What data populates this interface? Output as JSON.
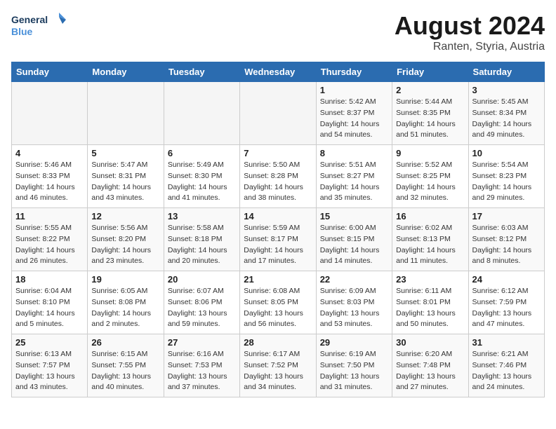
{
  "header": {
    "logo_line1": "General",
    "logo_line2": "Blue",
    "month": "August 2024",
    "location": "Ranten, Styria, Austria"
  },
  "weekdays": [
    "Sunday",
    "Monday",
    "Tuesday",
    "Wednesday",
    "Thursday",
    "Friday",
    "Saturday"
  ],
  "weeks": [
    [
      {
        "day": "",
        "info": ""
      },
      {
        "day": "",
        "info": ""
      },
      {
        "day": "",
        "info": ""
      },
      {
        "day": "",
        "info": ""
      },
      {
        "day": "1",
        "info": "Sunrise: 5:42 AM\nSunset: 8:37 PM\nDaylight: 14 hours\nand 54 minutes."
      },
      {
        "day": "2",
        "info": "Sunrise: 5:44 AM\nSunset: 8:35 PM\nDaylight: 14 hours\nand 51 minutes."
      },
      {
        "day": "3",
        "info": "Sunrise: 5:45 AM\nSunset: 8:34 PM\nDaylight: 14 hours\nand 49 minutes."
      }
    ],
    [
      {
        "day": "4",
        "info": "Sunrise: 5:46 AM\nSunset: 8:33 PM\nDaylight: 14 hours\nand 46 minutes."
      },
      {
        "day": "5",
        "info": "Sunrise: 5:47 AM\nSunset: 8:31 PM\nDaylight: 14 hours\nand 43 minutes."
      },
      {
        "day": "6",
        "info": "Sunrise: 5:49 AM\nSunset: 8:30 PM\nDaylight: 14 hours\nand 41 minutes."
      },
      {
        "day": "7",
        "info": "Sunrise: 5:50 AM\nSunset: 8:28 PM\nDaylight: 14 hours\nand 38 minutes."
      },
      {
        "day": "8",
        "info": "Sunrise: 5:51 AM\nSunset: 8:27 PM\nDaylight: 14 hours\nand 35 minutes."
      },
      {
        "day": "9",
        "info": "Sunrise: 5:52 AM\nSunset: 8:25 PM\nDaylight: 14 hours\nand 32 minutes."
      },
      {
        "day": "10",
        "info": "Sunrise: 5:54 AM\nSunset: 8:23 PM\nDaylight: 14 hours\nand 29 minutes."
      }
    ],
    [
      {
        "day": "11",
        "info": "Sunrise: 5:55 AM\nSunset: 8:22 PM\nDaylight: 14 hours\nand 26 minutes."
      },
      {
        "day": "12",
        "info": "Sunrise: 5:56 AM\nSunset: 8:20 PM\nDaylight: 14 hours\nand 23 minutes."
      },
      {
        "day": "13",
        "info": "Sunrise: 5:58 AM\nSunset: 8:18 PM\nDaylight: 14 hours\nand 20 minutes."
      },
      {
        "day": "14",
        "info": "Sunrise: 5:59 AM\nSunset: 8:17 PM\nDaylight: 14 hours\nand 17 minutes."
      },
      {
        "day": "15",
        "info": "Sunrise: 6:00 AM\nSunset: 8:15 PM\nDaylight: 14 hours\nand 14 minutes."
      },
      {
        "day": "16",
        "info": "Sunrise: 6:02 AM\nSunset: 8:13 PM\nDaylight: 14 hours\nand 11 minutes."
      },
      {
        "day": "17",
        "info": "Sunrise: 6:03 AM\nSunset: 8:12 PM\nDaylight: 14 hours\nand 8 minutes."
      }
    ],
    [
      {
        "day": "18",
        "info": "Sunrise: 6:04 AM\nSunset: 8:10 PM\nDaylight: 14 hours\nand 5 minutes."
      },
      {
        "day": "19",
        "info": "Sunrise: 6:05 AM\nSunset: 8:08 PM\nDaylight: 14 hours\nand 2 minutes."
      },
      {
        "day": "20",
        "info": "Sunrise: 6:07 AM\nSunset: 8:06 PM\nDaylight: 13 hours\nand 59 minutes."
      },
      {
        "day": "21",
        "info": "Sunrise: 6:08 AM\nSunset: 8:05 PM\nDaylight: 13 hours\nand 56 minutes."
      },
      {
        "day": "22",
        "info": "Sunrise: 6:09 AM\nSunset: 8:03 PM\nDaylight: 13 hours\nand 53 minutes."
      },
      {
        "day": "23",
        "info": "Sunrise: 6:11 AM\nSunset: 8:01 PM\nDaylight: 13 hours\nand 50 minutes."
      },
      {
        "day": "24",
        "info": "Sunrise: 6:12 AM\nSunset: 7:59 PM\nDaylight: 13 hours\nand 47 minutes."
      }
    ],
    [
      {
        "day": "25",
        "info": "Sunrise: 6:13 AM\nSunset: 7:57 PM\nDaylight: 13 hours\nand 43 minutes."
      },
      {
        "day": "26",
        "info": "Sunrise: 6:15 AM\nSunset: 7:55 PM\nDaylight: 13 hours\nand 40 minutes."
      },
      {
        "day": "27",
        "info": "Sunrise: 6:16 AM\nSunset: 7:53 PM\nDaylight: 13 hours\nand 37 minutes."
      },
      {
        "day": "28",
        "info": "Sunrise: 6:17 AM\nSunset: 7:52 PM\nDaylight: 13 hours\nand 34 minutes."
      },
      {
        "day": "29",
        "info": "Sunrise: 6:19 AM\nSunset: 7:50 PM\nDaylight: 13 hours\nand 31 minutes."
      },
      {
        "day": "30",
        "info": "Sunrise: 6:20 AM\nSunset: 7:48 PM\nDaylight: 13 hours\nand 27 minutes."
      },
      {
        "day": "31",
        "info": "Sunrise: 6:21 AM\nSunset: 7:46 PM\nDaylight: 13 hours\nand 24 minutes."
      }
    ]
  ]
}
